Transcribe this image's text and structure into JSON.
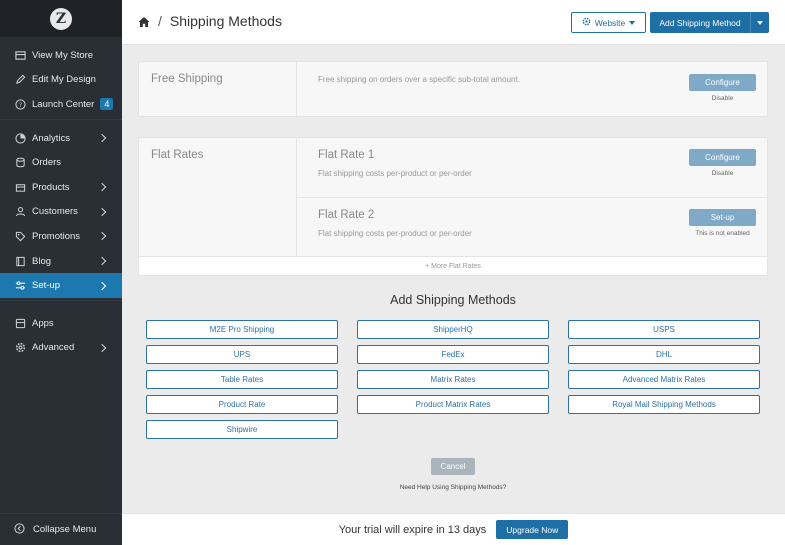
{
  "sidebar": {
    "logo": "Z",
    "group1": [
      {
        "label": "View My Store",
        "icon": "store-icon"
      },
      {
        "label": "Edit My Design",
        "icon": "pencil-icon"
      },
      {
        "label": "Launch Center",
        "icon": "question-icon",
        "badge": "4"
      }
    ],
    "group2": [
      {
        "label": "Analytics",
        "icon": "analytics-icon",
        "chevron": true
      },
      {
        "label": "Orders",
        "icon": "database-icon",
        "chevron": false
      },
      {
        "label": "Products",
        "icon": "box-icon",
        "chevron": true
      },
      {
        "label": "Customers",
        "icon": "user-icon",
        "chevron": true
      },
      {
        "label": "Promotions",
        "icon": "tag-icon",
        "chevron": true
      },
      {
        "label": "Blog",
        "icon": "book-icon",
        "chevron": true
      },
      {
        "label": "Set-up",
        "icon": "sliders-icon",
        "chevron": true,
        "active": true
      }
    ],
    "group3": [
      {
        "label": "Apps",
        "icon": "apps-icon",
        "chevron": false
      },
      {
        "label": "Advanced",
        "icon": "gear-icon",
        "chevron": true
      }
    ],
    "collapse_label": "Collapse Menu"
  },
  "header": {
    "breadcrumb_sep": "/",
    "title": "Shipping Methods",
    "website_label": "Website",
    "add_label": "Add Shipping Method"
  },
  "free_shipping": {
    "title": "Free Shipping",
    "desc": "Free shipping on orders over a specific sub-total amount.",
    "button": "Configure",
    "status": "Disable"
  },
  "flat_rates": {
    "title": "Flat Rates",
    "items": [
      {
        "title": "Flat Rate 1",
        "desc": "Flat shipping costs per-product or per-order",
        "button": "Configure",
        "status": "Disable"
      },
      {
        "title": "Flat Rate 2",
        "desc": "Flat shipping costs per-product or per-order",
        "button": "Set-up",
        "status": "This is not enabled"
      }
    ],
    "more": "+ More Flat Rates"
  },
  "add_methods": {
    "title": "Add Shipping Methods",
    "buttons": [
      "M2E Pro Shipping",
      "ShipperHQ",
      "USPS",
      "UPS",
      "FedEx",
      "DHL",
      "Table Rates",
      "Matrix Rates",
      "Advanced Matrix Rates",
      "Product Rate",
      "Product Matrix Rates",
      "Royal Mail Shipping Methods",
      "Shipwire"
    ],
    "cancel": "Cancel",
    "help": "Need Help Using Shipping Methods?"
  },
  "footer": {
    "trial_text": "Your trial will expire in 13 days",
    "upgrade_label": "Upgrade Now"
  },
  "colors": {
    "sidebar_bg": "#2a2f35",
    "accent": "#1e6fa6",
    "active_nav": "#1e78b0"
  }
}
